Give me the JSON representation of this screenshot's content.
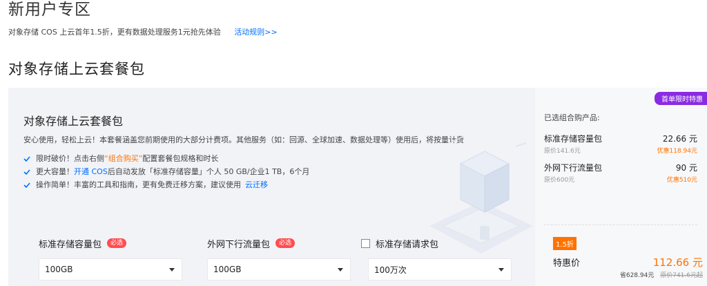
{
  "page": {
    "heading": "新用户专区",
    "promo_text": "对象存储 COS 上云首年1.5折，更有数据处理服务1元抢先体验",
    "rules_link": "活动规则>>",
    "section_title": "对象存储上云套餐包"
  },
  "card": {
    "title": "对象存储上云套餐包",
    "description": "安心使用，轻松上云！本套餐涵盖您前期使用的大部分计费项。其他服务（如：回源、全球加速、数据处理等）使用后，将按量计费",
    "features": [
      {
        "a": "限时破价！点击右侧",
        "b": "“组合购买”",
        "c": "配置套餐包规格和时长"
      },
      {
        "a": "更大容量！",
        "b": "开通 COS",
        "c": "后自动发放「标准存储容量」个人 50 GB/企业1 TB，6个月"
      },
      {
        "a": "操作简单！丰富的工具和指南，更有免费迁移方案，建议使用",
        "b": "云迁移",
        "c": ""
      }
    ],
    "fields": [
      {
        "label": "标准存储容量包",
        "badge": "必选",
        "value": "100GB"
      },
      {
        "label": "外网下行流量包",
        "badge": "必选",
        "value": "100GB"
      },
      {
        "label": "标准存储请求包",
        "badge": "",
        "value": "100万次"
      }
    ]
  },
  "summary": {
    "flag": "首单限时特惠",
    "heading": "已选组合购产品:",
    "items": [
      {
        "name": "标准存储容量包",
        "price": "22.66 元",
        "original": "原价141.6元",
        "discount": "优惠118.94元"
      },
      {
        "name": "外网下行流量包",
        "price": "90 元",
        "original": "原价600元",
        "discount": "优惠510元"
      }
    ],
    "discount_badge": "1.5折",
    "special_label": "特惠价",
    "special_price": "112.66 元",
    "savings": "省628.94元",
    "original_total": "原价741.6元起"
  },
  "colors": {
    "accent_blue": "#006eff",
    "accent_orange": "#ff7200",
    "required_red": "#ff4d4f",
    "flag_purple": "#8a2be2"
  }
}
